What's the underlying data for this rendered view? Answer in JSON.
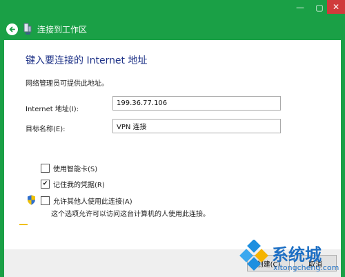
{
  "window": {
    "minimize_glyph": "—",
    "maximize_glyph": "▢",
    "close_glyph": "✕",
    "accent_color": "#1aa046",
    "close_color": "#d03b3b"
  },
  "header": {
    "title": "连接到工作区",
    "back_icon": "back-arrow-icon",
    "network_icon": "network-icon"
  },
  "page": {
    "heading": "键入要连接的 Internet 地址",
    "description": "网络管理员可提供此地址。"
  },
  "form": {
    "address_label": "Internet 地址(I):",
    "address_value": "199.36.77.106",
    "name_label": "目标名称(E):",
    "name_value": "VPN 连接"
  },
  "options": {
    "smartcard_label": "使用智能卡(S)",
    "smartcard_checked": false,
    "remember_label": "记住我的凭据(R)",
    "remember_checked": true,
    "allow_label": "允许其他人使用此连接(A)",
    "allow_checked": false,
    "allow_note": "这个选项允许可以访问这台计算机的人使用此连接。",
    "shield_icon": "uac-shield-icon"
  },
  "buttons": {
    "create_label": "创建(C)",
    "cancel_label": "取消"
  },
  "watermark": {
    "brand": "系统城",
    "url": "xitongcheng.com"
  }
}
